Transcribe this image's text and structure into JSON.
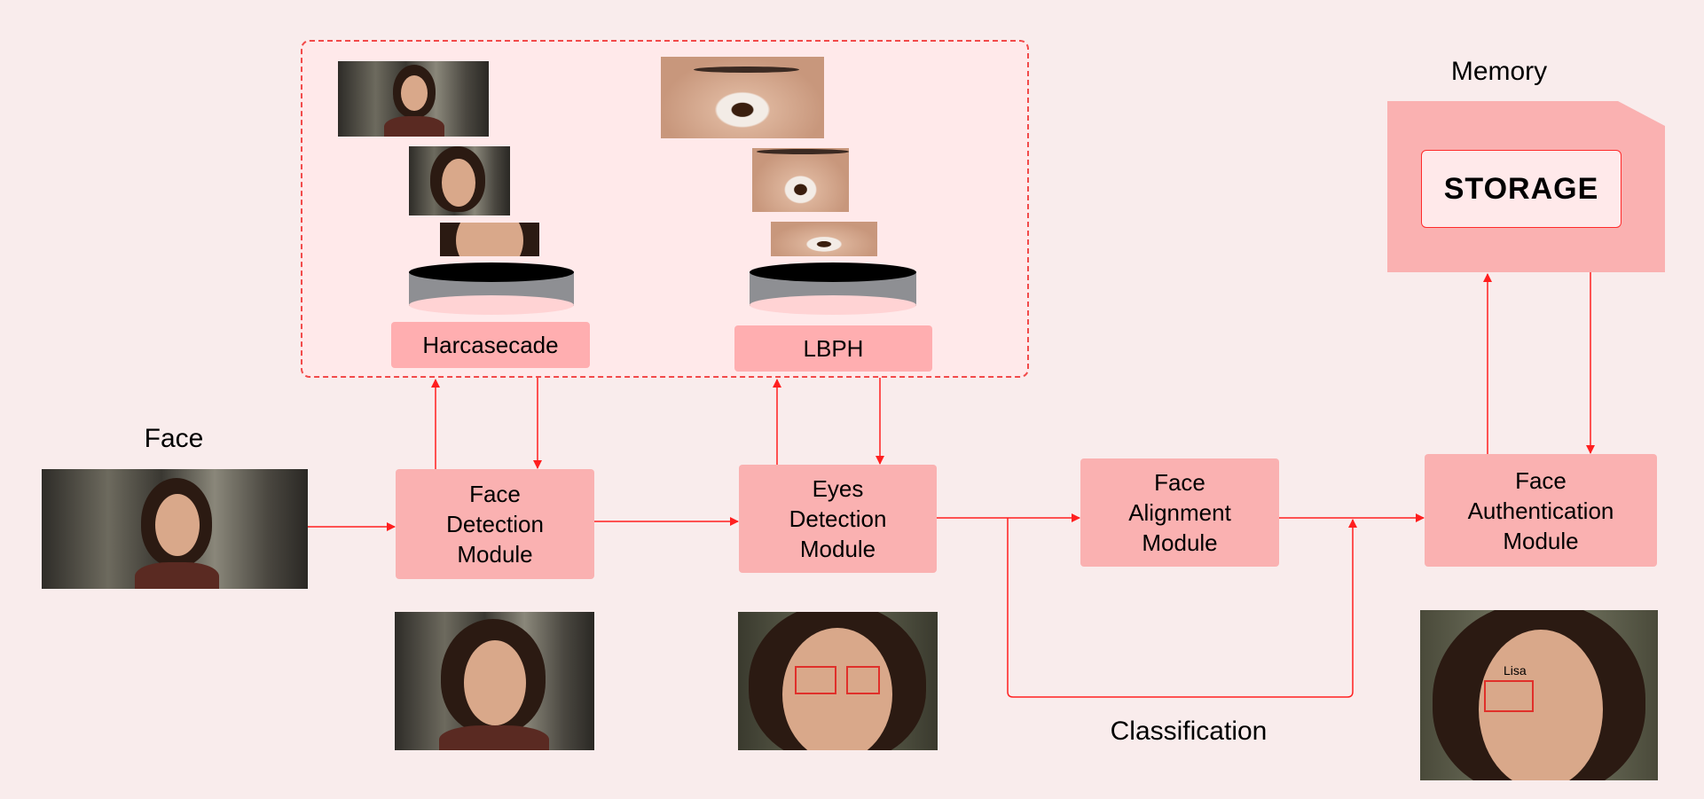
{
  "labels": {
    "face": "Face",
    "memory": "Memory",
    "classification": "Classification"
  },
  "storage": {
    "label": "STORAGE"
  },
  "classifiers": {
    "haar": "Harcasecade",
    "lbph": "LBPH"
  },
  "modules": {
    "face_detection": "Face\nDetection\nModule",
    "eyes_detection": "Eyes\nDetection\nModule",
    "face_alignment": "Face\nAlignment\nModule",
    "face_authentication": "Face\nAuthentication\nModule"
  },
  "recognition": {
    "name": "Lisa"
  },
  "colors": {
    "background": "#f9ecec",
    "module_fill": "#fab1b1",
    "arrow": "#ff1f1f",
    "dashed_panel": "#ffe9ea"
  }
}
